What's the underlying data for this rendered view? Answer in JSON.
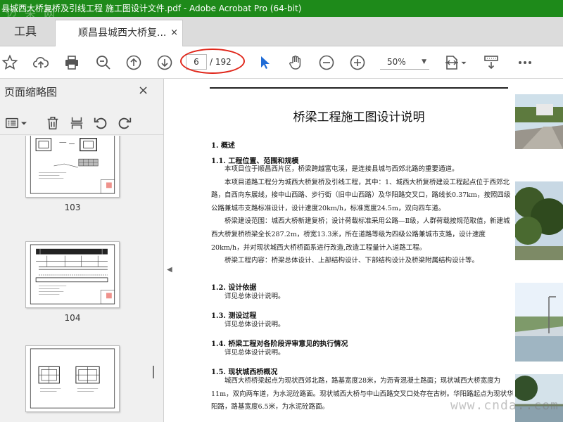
{
  "window": {
    "title": "县城西大桥复桥及引线工程 施工图设计文件.pdf - Adobe Acrobat Pro (64-bit)",
    "watermark": "迈 未 网"
  },
  "tabs": {
    "tools_label": "工具",
    "doc_label": "顺昌县城西大桥复...",
    "close": "×"
  },
  "toolbar": {
    "current_page": "6",
    "total_pages": "/ 192",
    "zoom": "50%",
    "icons": [
      "star-icon",
      "upload-icon",
      "print-icon",
      "zoom-out-magnifier-icon",
      "page-up-icon",
      "page-down-icon",
      "select-cursor-icon",
      "hand-icon",
      "zoom-out-icon",
      "zoom-in-icon",
      "fit-page-icon",
      "scroll-mode-icon",
      "more-icon"
    ],
    "accent": "#1f6bd6",
    "annotation_color": "#e0261a"
  },
  "sidebar": {
    "title": "页面缩略图",
    "close": "×",
    "thumbnails": [
      {
        "label": "103"
      },
      {
        "label": "104"
      },
      {
        "label": ""
      }
    ]
  },
  "document": {
    "title": "桥梁工程施工图设计说明",
    "sections": [
      {
        "heading": "1.  概述"
      },
      {
        "heading": "1.1.  工程位置、范围和规模"
      },
      {
        "heading": "1.2.  设计依据"
      },
      {
        "heading": "1.3.  测设过程"
      },
      {
        "heading": "1.4.  桥梁工程对各阶段评审意见的执行情况"
      },
      {
        "heading": "1.5.  现状城西桥概况"
      }
    ],
    "paragraphs": {
      "p1": "本项目位于顺昌西片区，桥梁跨越富屯溪，是连接县城与西郊北路的重要通道。",
      "p2": "本项目道路工程分为城西大桥复桥及引线工程，其中：1、城西大桥复桥建设工程起点位于西郊北路，自西向东展线，接中山西路、步行街（旧中山西路）及华阳路交叉口，路线长0.37km，按照四级公路兼城市支路标准设计，设计速度20km/h，标准宽度24.5m，双向四车道。",
      "p3": "桥梁建设范围：城西大桥新建复桥；设计荷载标准采用公路—Ⅱ级，人群荷载按规范取值，新建城西大桥复桥桥梁全长287.2m，桥宽13.3米，所在道路等级为四级公路兼城市支路，设计速度20km/h，并对现状城西大桥桥面系进行改造,改造工程量计入道路工程。",
      "p4": "桥梁工程内容：桥梁总体设计、上部结构设计、下部结构设计及桥梁附属结构设计等。",
      "p5": "详见总体设计说明。",
      "p6": "详见总体设计说明。",
      "p7": "详见总体设计说明。",
      "p8": "城西大桥桥梁起点为现状西郊北路，路基宽度28米，为沥青混凝土路面；现状城西大桥宽度为11m，双向两车道，为水泥砼路面。现状城西大桥与中山西路交叉口处存在古树。华阳路起点为现状华阳路，路基宽度6.5米，为水泥砼路面。"
    },
    "watermark": "www.cnda..com"
  }
}
